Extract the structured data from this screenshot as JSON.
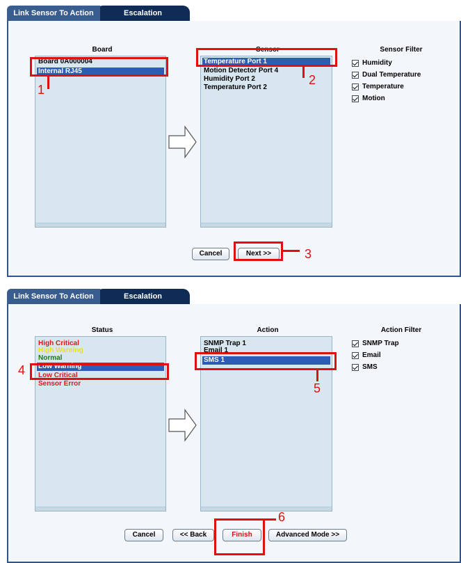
{
  "step1": {
    "tabs": [
      "Link Sensor To Action",
      "Escalation"
    ],
    "board": {
      "header": "Board",
      "items": [
        "Board 0A000004",
        "Internal RJ45"
      ],
      "selected": "Internal RJ45"
    },
    "sensor": {
      "header": "Sensor",
      "items": [
        "Temperature Port 1",
        "Motion Detector Port 4",
        "Humidity Port 2",
        "Temperature Port 2"
      ],
      "selected": "Temperature Port 1"
    },
    "filter": {
      "header": "Sensor Filter",
      "items": [
        "Humidity",
        "Dual Temperature",
        "Temperature",
        "Motion"
      ]
    },
    "buttons": {
      "cancel": "Cancel",
      "next": "Next >>"
    },
    "markers": [
      "1",
      "2",
      "3"
    ]
  },
  "step2": {
    "tabs": [
      "Link Sensor To Action",
      "Escalation"
    ],
    "status": {
      "header": "Status",
      "items": [
        {
          "label": "High Critical",
          "color": "#e01818"
        },
        {
          "label": "High Warning",
          "color": "#e8e020"
        },
        {
          "label": "Normal",
          "color": "#1a7a1a"
        },
        {
          "label": "Low Warning",
          "color": "#ffffff"
        },
        {
          "label": "Low Critical",
          "color": "#e01818"
        },
        {
          "label": "Sensor Error",
          "color": "#e01818"
        }
      ],
      "selected": "Low Warning"
    },
    "action": {
      "header": "Action",
      "items": [
        "SNMP Trap 1",
        "Email 1",
        "SMS 1"
      ],
      "selected": "SMS 1"
    },
    "filter": {
      "header": "Action Filter",
      "items": [
        "SNMP Trap",
        "Email",
        "SMS"
      ]
    },
    "buttons": {
      "cancel": "Cancel",
      "back": "<< Back",
      "finish": "Finish",
      "advanced": "Advanced Mode >>"
    },
    "markers": [
      "4",
      "5",
      "6"
    ]
  },
  "colors": {
    "tab_active": "#3a5d8f",
    "tab_inactive": "#0f2c56",
    "selection": "#2d5cb5",
    "highlight": "#e01010",
    "list_bg": "#d8e6ef"
  }
}
